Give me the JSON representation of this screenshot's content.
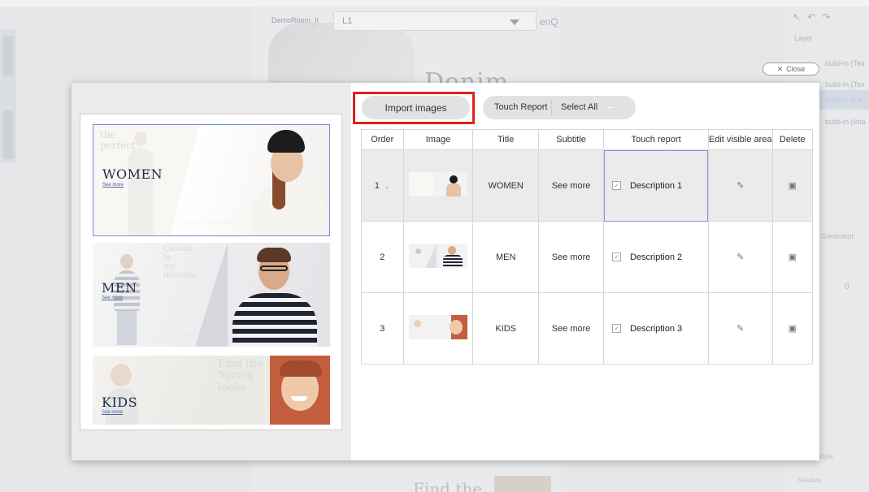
{
  "background": {
    "room_name": "DemoRoom_II",
    "layer_select_value": "L1",
    "brand_partial": "enQ",
    "canvas_heading": "Denim",
    "canvas_footer_text": "Find the",
    "panel": {
      "layer_title": "Layer",
      "layers": [
        "build-in (Tex",
        "build-in (Tex",
        "build-in (Ca",
        "build-in (Ima"
      ],
      "generator_text": "y Generator",
      "zero_value": "0",
      "style_label": "Style",
      "shadow_label": "Shadow"
    }
  },
  "close_button": {
    "icon": "close-icon",
    "label": "Close"
  },
  "preview": {
    "banners": [
      {
        "title": "WOMEN",
        "link": "See more",
        "ghost": "the\nperfect"
      },
      {
        "title": "MEN",
        "link": "See more",
        "ghost": "Casual\nis\nmy\nlifestyle"
      },
      {
        "title": "KIDS",
        "link": "See more",
        "ghost": "Find the\nSpring\nlooks"
      }
    ]
  },
  "toolbar": {
    "import_label": "Import images",
    "touch_report_label": "Touch Report",
    "select_all_label": "Select All"
  },
  "table": {
    "headers": [
      "Order",
      "Image",
      "Title",
      "Subtitle",
      "Touch report",
      "Edit visible area",
      "Delete"
    ],
    "rows": [
      {
        "order": "1",
        "title": "WOMEN",
        "subtitle": "See more",
        "touch_checked": true,
        "description": "Description 1"
      },
      {
        "order": "2",
        "title": "MEN",
        "subtitle": "See more",
        "touch_checked": true,
        "description": "Description 2"
      },
      {
        "order": "3",
        "title": "KIDS",
        "subtitle": "See more",
        "touch_checked": true,
        "description": "Description 3"
      }
    ]
  },
  "colors": {
    "highlight": "#e0211c",
    "selection_border": "#6d8fca",
    "banner_title": "#1e2a4a"
  }
}
